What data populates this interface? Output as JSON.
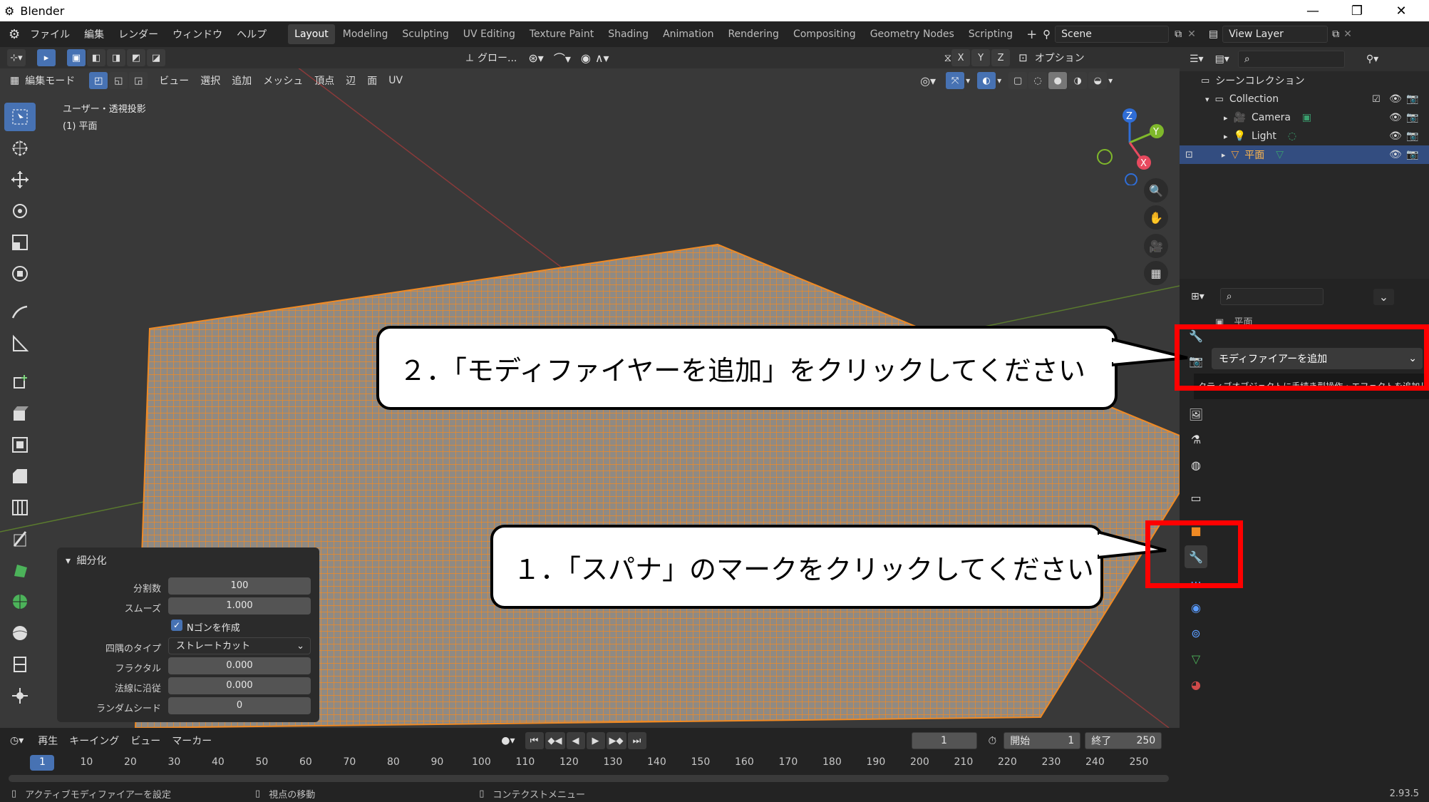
{
  "window": {
    "title": "Blender"
  },
  "menubar": {
    "menus": [
      "ファイル",
      "編集",
      "レンダー",
      "ウィンドウ",
      "ヘルプ"
    ],
    "workspaces": [
      "Layout",
      "Modeling",
      "Sculpting",
      "UV Editing",
      "Texture Paint",
      "Shading",
      "Animation",
      "Rendering",
      "Compositing",
      "Geometry Nodes",
      "Scripting"
    ],
    "scene": "Scene",
    "view_layer": "View Layer"
  },
  "viewport": {
    "transform_orientation": "グロー...",
    "options_label": "オプション",
    "mode": "編集モード",
    "header_menus": [
      "ビュー",
      "選択",
      "追加",
      "メッシュ",
      "頂点",
      "辺",
      "面",
      "UV"
    ],
    "view_name": "ユーザー・透視投影",
    "object_name": "(1) 平面",
    "axes": [
      "X",
      "Y",
      "Z"
    ]
  },
  "operator_panel": {
    "title": "細分化",
    "fields": [
      {
        "label": "分割数",
        "value": "100"
      },
      {
        "label": "スムーズ",
        "value": "1.000"
      },
      {
        "label": "四隅のタイプ",
        "value": "ストレートカット"
      },
      {
        "label": "フラクタル",
        "value": "0.000"
      },
      {
        "label": "法線に沿従",
        "value": "0.000"
      },
      {
        "label": "ランダムシード",
        "value": "0"
      }
    ],
    "checkbox_label": "Nゴンを作成"
  },
  "callouts": {
    "step1": "１．「スパナ」のマークをクリックしてください",
    "step2": "２．「モディファイヤーを追加」をクリックしてください"
  },
  "outliner": {
    "root": "シーンコレクション",
    "collection": "Collection",
    "items": [
      "Camera",
      "Light",
      "平面"
    ]
  },
  "properties": {
    "object_name": "平面",
    "add_modifier_button": "モディファイアーを追加",
    "tooltip": "クティブオブジェクトに手続き型操作・エフェクトを追加します."
  },
  "timeline": {
    "menus": [
      "再生",
      "キーイング",
      "ビュー",
      "マーカー"
    ],
    "current_frame": "1",
    "start_label": "開始",
    "start": "1",
    "end_label": "終了",
    "end": "250",
    "ruler": [
      "1",
      "10",
      "20",
      "30",
      "40",
      "50",
      "60",
      "70",
      "80",
      "90",
      "100",
      "110",
      "120",
      "130",
      "140",
      "150",
      "160",
      "170",
      "180",
      "190",
      "200",
      "210",
      "220",
      "230",
      "240",
      "250"
    ]
  },
  "statusbar": {
    "left": "アクティブモディファイアーを設定",
    "mid": "視点の移動",
    "right": "コンテクストメニュー",
    "version": "2.93.5"
  },
  "colors": {
    "accent": "#4772b3",
    "mesh": "#f08a24",
    "highlight": "#ff0000"
  }
}
